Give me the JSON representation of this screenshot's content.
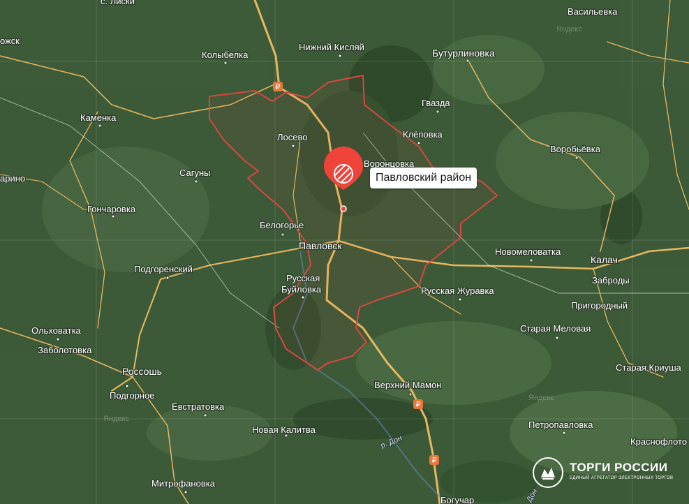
{
  "map": {
    "selected_label": "Павловский район",
    "watermark": "Яндекс",
    "river_label": "р. Дон",
    "river_label_partial": "Дон",
    "cities": [
      "с. Лиски",
      "ожск",
      "Колыбелка",
      "Нижний Кисляй",
      "Бутурлиновка",
      "Васильевка",
      "Каменка",
      "Гвазда",
      "Лосево",
      "Клёповка",
      "Воробьёвка",
      "Воронцовка",
      "арино",
      "Сагуны",
      "Гончаровка",
      "Белогорье",
      "Павловск",
      "Новомеловатка",
      "Калач",
      "Подгоренский",
      "Русская",
      "Буйловка",
      "Заброды",
      "Русская Журавка",
      "Пригородный",
      "Ольховатка",
      "Заболотовка",
      "Старая Меловая",
      "Россошь",
      "Старая Криуша",
      "Верхний Мамон",
      "Подгорное",
      "Евстратовка",
      "Новая Калитва",
      "Петропавловка",
      "Краснофлото",
      "Митрофановка",
      "Богучар"
    ]
  },
  "brand": {
    "title": "ТОРГИ РОССИИ",
    "subtitle": "ЕДИНЫЙ АГРЕГАТОР ЭЛЕКТРОННЫХ ТОРГОВ"
  },
  "colors": {
    "district_border": "#d9473f",
    "marker": "#f0433a",
    "road": "#e8b860",
    "terrain": "#3f5a3a"
  },
  "icons": [
    "map-pin-icon",
    "ruble-icon",
    "torgi-logo-icon"
  ]
}
